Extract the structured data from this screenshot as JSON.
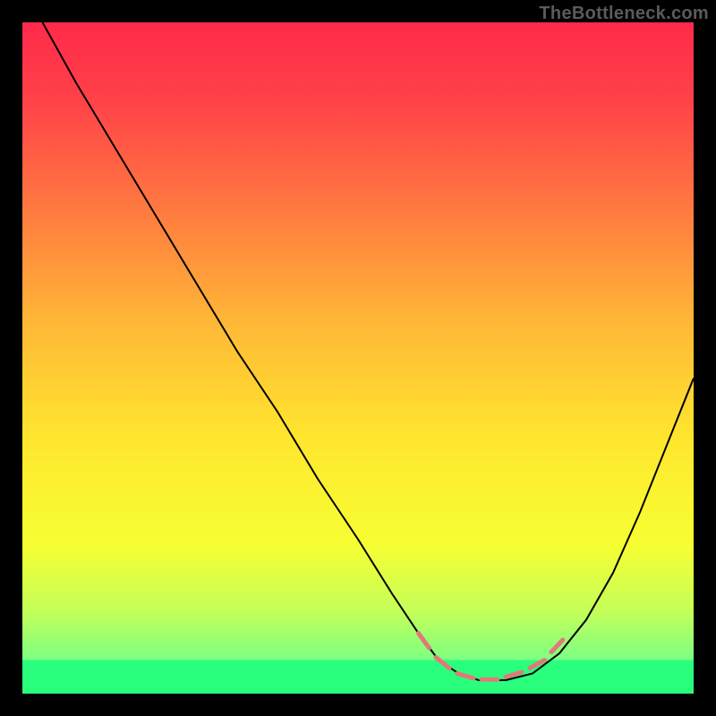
{
  "watermark": "TheBottleneck.com",
  "chart_data": {
    "type": "line",
    "title": "",
    "xlabel": "",
    "ylabel": "",
    "xlim": [
      0,
      100
    ],
    "ylim": [
      0,
      100
    ],
    "background_gradient": {
      "stops": [
        {
          "offset": 0.0,
          "color": "#ff2a4b"
        },
        {
          "offset": 0.12,
          "color": "#ff4348"
        },
        {
          "offset": 0.28,
          "color": "#ff7a40"
        },
        {
          "offset": 0.45,
          "color": "#ffb836"
        },
        {
          "offset": 0.62,
          "color": "#ffe62e"
        },
        {
          "offset": 0.78,
          "color": "#f6ff33"
        },
        {
          "offset": 0.88,
          "color": "#c2ff5a"
        },
        {
          "offset": 0.95,
          "color": "#7cff82"
        },
        {
          "offset": 1.0,
          "color": "#2aff7d"
        }
      ]
    },
    "green_band": {
      "y_top": 95,
      "y_bottom": 100
    },
    "series": [
      {
        "name": "bottleneck-curve",
        "color": "#000000",
        "width": 2,
        "x": [
          3,
          8,
          14,
          20,
          26,
          32,
          38,
          44,
          50,
          55,
          59,
          62,
          65,
          68,
          72,
          76,
          80,
          84,
          88,
          92,
          96,
          100
        ],
        "y": [
          0,
          9,
          19,
          29,
          39,
          49,
          58,
          68,
          77,
          85,
          91,
          95,
          97,
          98,
          98,
          97,
          94,
          89,
          82,
          73,
          63,
          53
        ]
      }
    ],
    "dashed_valley": {
      "color": "#e07a7a",
      "width": 5,
      "segments": [
        {
          "x1": 59.0,
          "y1": 91.0,
          "x2": 60.6,
          "y2": 93.2
        },
        {
          "x1": 61.6,
          "y1": 94.6,
          "x2": 63.6,
          "y2": 96.2
        },
        {
          "x1": 64.8,
          "y1": 97.0,
          "x2": 67.2,
          "y2": 97.7
        },
        {
          "x1": 68.4,
          "y1": 97.9,
          "x2": 70.8,
          "y2": 97.9
        },
        {
          "x1": 72.0,
          "y1": 97.5,
          "x2": 74.4,
          "y2": 96.8
        },
        {
          "x1": 75.6,
          "y1": 96.2,
          "x2": 77.8,
          "y2": 95.0
        },
        {
          "x1": 78.8,
          "y1": 93.8,
          "x2": 80.5,
          "y2": 92.0
        }
      ]
    }
  }
}
